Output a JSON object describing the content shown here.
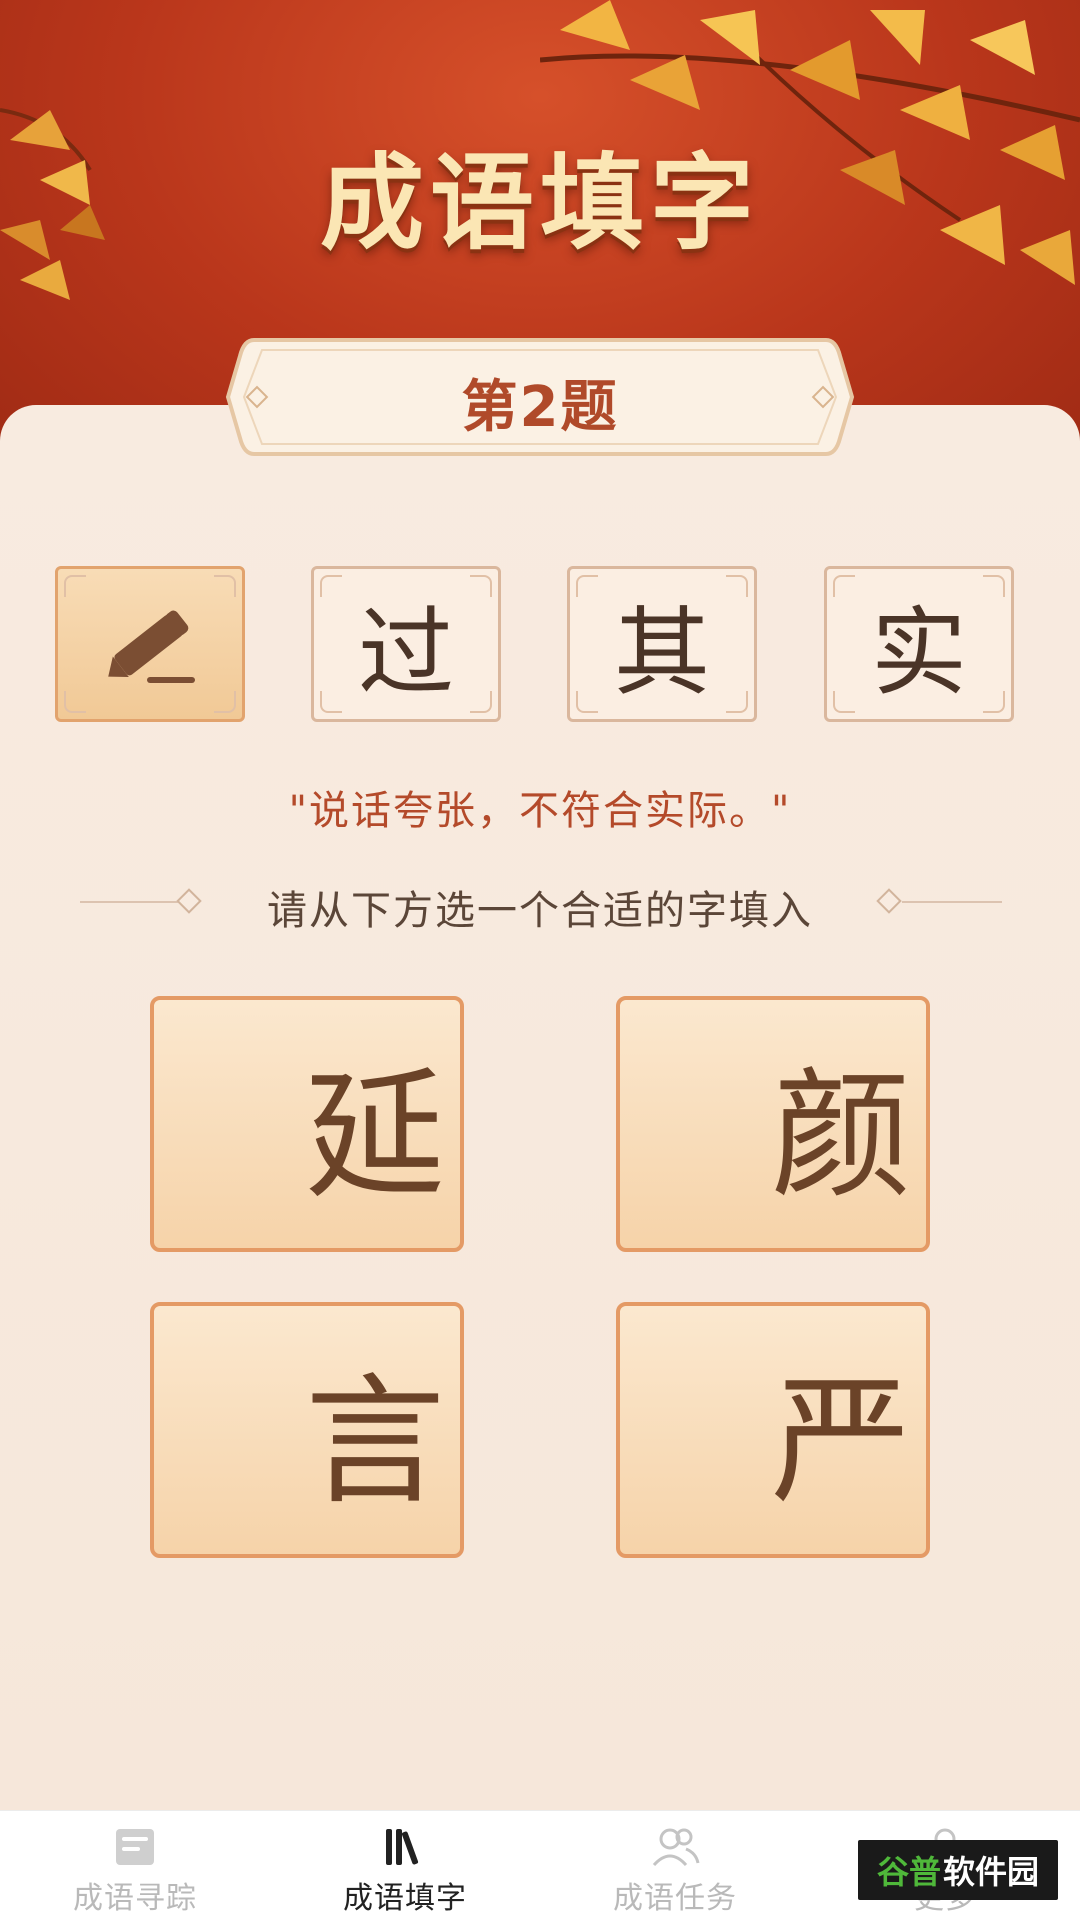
{
  "header": {
    "title": "成语填字"
  },
  "question": {
    "label": "第2题"
  },
  "idiom": {
    "blank_icon": "pencil-icon",
    "chars": [
      "过",
      "其",
      "实"
    ]
  },
  "definition": "\"说话夸张，不符合实际。\"",
  "instruction": "请从下方选一个合适的字填入",
  "options": [
    "延",
    "颜",
    "言",
    "严"
  ],
  "nav": {
    "items": [
      {
        "label": "成语寻踪",
        "icon": "book-icon",
        "active": false
      },
      {
        "label": "成语填字",
        "icon": "books-icon",
        "active": true
      },
      {
        "label": "成语任务",
        "icon": "users-icon",
        "active": false
      },
      {
        "label": "更多",
        "icon": "more-icon",
        "active": false
      }
    ]
  },
  "watermark": {
    "part1": "谷普",
    "part2": "软件园"
  },
  "colors": {
    "header_red": "#b9361b",
    "title_gold": "#fbe6b4",
    "accent_text": "#b44a2a",
    "option_border": "#e49a65"
  }
}
